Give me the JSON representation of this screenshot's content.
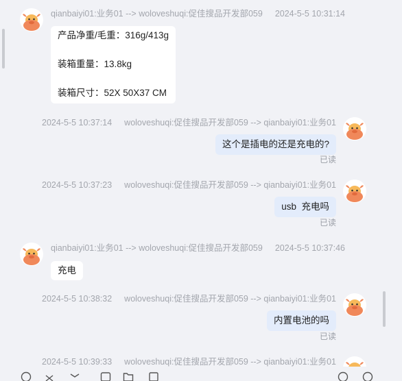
{
  "messages": [
    {
      "side": "left",
      "sender": "qianbaiyi01:业务01 --> woloveshuqi:促佳搜品开发部059",
      "time": "2024-5-5 10:31:14",
      "lines": [
        "产品净重/毛重：316g/413g",
        "装箱重量：13.8kg",
        "装箱尺寸：52X 50X37 CM"
      ]
    },
    {
      "side": "right",
      "sender": "woloveshuqi:促佳搜品开发部059 --> qianbaiyi01:业务01",
      "time": "2024-5-5 10:37:14",
      "text": "这个是插电的还是充电的?",
      "status": "已读"
    },
    {
      "side": "right",
      "sender": "woloveshuqi:促佳搜品开发部059 --> qianbaiyi01:业务01",
      "time": "2024-5-5 10:37:23",
      "text": "usb  充电吗",
      "status": "已读"
    },
    {
      "side": "left",
      "sender": "qianbaiyi01:业务01 --> woloveshuqi:促佳搜品开发部059",
      "time": "2024-5-5 10:37:46",
      "text": "充电"
    },
    {
      "side": "right",
      "sender": "woloveshuqi:促佳搜品开发部059 --> qianbaiyi01:业务01",
      "time": "2024-5-5 10:38:32",
      "text": "内置电池的吗",
      "status": "已读"
    },
    {
      "side": "right",
      "sender": "woloveshuqi:促佳搜品开发部059 --> qianbaiyi01:业务01",
      "time": "2024-5-5 10:39:33"
    }
  ],
  "toolbar": {
    "icons": [
      "emoji-icon",
      "scissors-icon",
      "image-icon",
      "folder-icon",
      "document-icon",
      "history-icon",
      "more-icon"
    ]
  },
  "colors": {
    "background": "#f1f2f6",
    "bubble_incoming": "#ffffff",
    "bubble_outgoing": "#e3ecfb",
    "avatar_accent": "#f0885a"
  }
}
